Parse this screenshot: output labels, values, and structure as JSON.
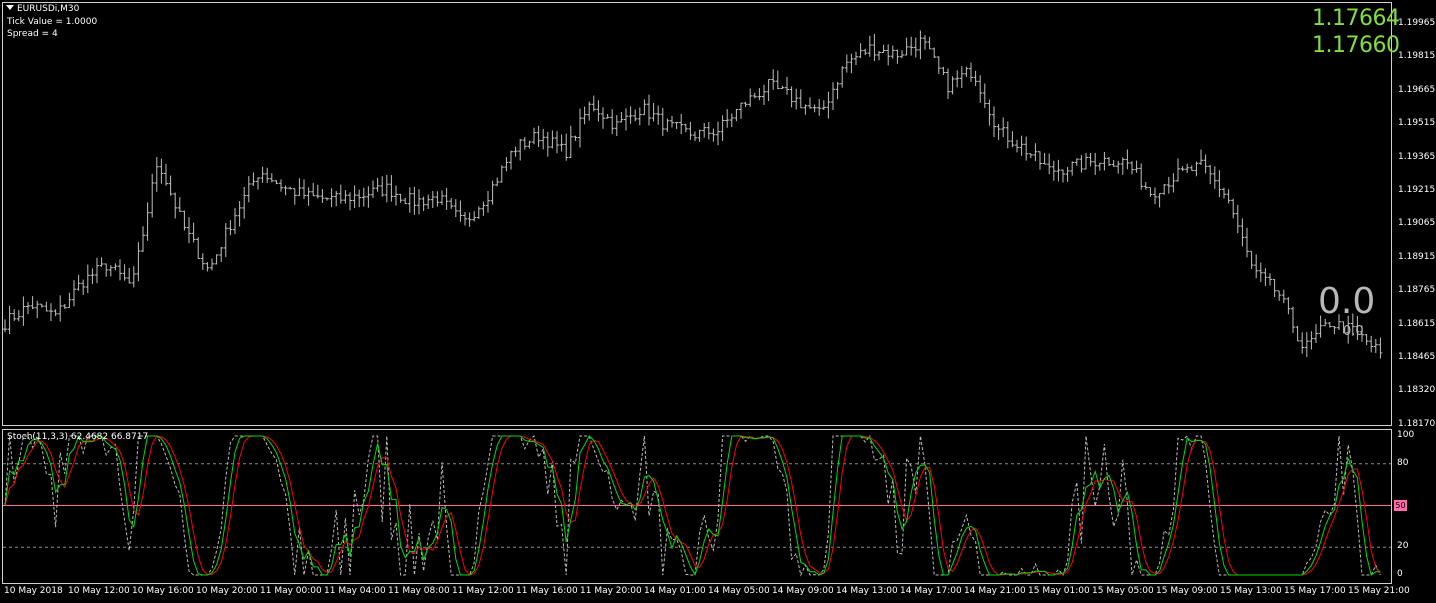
{
  "header": {
    "symbol_title": "EURUSDi,M30",
    "tick_value": "Tick Value = 1.0000",
    "spread": "Spread = 4"
  },
  "quotes": {
    "ask": "1.17664",
    "bid": "1.17660",
    "counter_big": "0.0",
    "counter_small": "0.0"
  },
  "price_axis": [
    "1.19965",
    "1.19815",
    "1.19665",
    "1.19515",
    "1.19365",
    "1.19215",
    "1.19065",
    "1.18915",
    "1.18765",
    "1.18615",
    "1.18465",
    "1.18320",
    "1.18170"
  ],
  "stoch": {
    "label": "Stoch(11,3,3) 62.4682 66.8717",
    "axis": [
      "100",
      "80",
      "50",
      "20",
      "0"
    ],
    "level_tag": "50",
    "colors": {
      "main": "#00dd00",
      "signal": "#ff0000",
      "levels": "#8a8a8a",
      "level50": "#ff6a9a"
    }
  },
  "time_axis": [
    "10 May 2018",
    "10 May 12:00",
    "10 May 16:00",
    "10 May 20:00",
    "11 May 00:00",
    "11 May 04:00",
    "11 May 08:00",
    "11 May 12:00",
    "11 May 16:00",
    "11 May 20:00",
    "14 May 01:00",
    "14 May 05:00",
    "14 May 09:00",
    "14 May 13:00",
    "14 May 17:00",
    "14 May 21:00",
    "15 May 01:00",
    "15 May 05:00",
    "15 May 09:00",
    "15 May 13:00",
    "15 May 17:00",
    "15 May 21:00"
  ],
  "colors": {
    "background": "#000000",
    "bars": "#c0c0c0",
    "quote": "#7fe03a",
    "frame": "#d0d0d0"
  },
  "chart_data": [
    {
      "type": "ohlc",
      "symbol": "EURUSDi",
      "timeframe": "M30",
      "approx_close_path": [
        1.1862,
        1.187,
        1.1865,
        1.188,
        1.1888,
        1.1878,
        1.1935,
        1.1905,
        1.1885,
        1.191,
        1.193,
        1.1922,
        1.1918,
        1.1917,
        1.1919,
        1.1922,
        1.1916,
        1.1918,
        1.1906,
        1.192,
        1.194,
        1.1946,
        1.1938,
        1.196,
        1.195,
        1.1958,
        1.195,
        1.1946,
        1.1948,
        1.196,
        1.1968,
        1.1962,
        1.1955,
        1.1978,
        1.1985,
        1.1982,
        1.1988,
        1.1968,
        1.1975,
        1.1948,
        1.194,
        1.193,
        1.1932,
        1.1935,
        1.1934,
        1.192,
        1.1928,
        1.1932,
        1.1918,
        1.1885,
        1.1875,
        1.185,
        1.1862,
        1.1858,
        1.1848
      ]
    },
    {
      "type": "line",
      "name": "Stoch(11,3,3)",
      "main_last": 62.4682,
      "signal_last": 66.8717,
      "ylim": [
        0,
        100
      ],
      "levels": [
        20,
        50,
        80
      ]
    }
  ]
}
